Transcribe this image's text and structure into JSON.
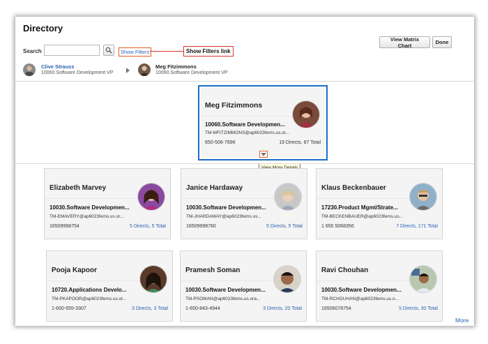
{
  "page": {
    "title": "Directory",
    "search_label": "Search",
    "search_value": "",
    "show_filters": "Show Filters",
    "callout": "Show Filters link",
    "btn_matrix": "View Matrix Chart",
    "btn_done": "Done",
    "more": "More",
    "tooltip": "View More Details"
  },
  "breadcrumb": [
    {
      "name": "Clive Strauss",
      "org": "10060.Software Development VP"
    },
    {
      "name": "Meg Fitzimmons",
      "org": "10060.Software Development VP"
    }
  ],
  "featured": {
    "name": "Meg Fitzimmons",
    "dept": "10060.Software Developmen...",
    "email": "TM-MFITZIMMONS@ap6023fems.us.or...",
    "phone": "650-506-7896",
    "directs": "19 Directs, 87 Total"
  },
  "reports": [
    {
      "name": "Elizabeth Marvey",
      "dept": "10030.Software Developmen...",
      "email": "TM-EMAVERY@ap6023fems.us.or...",
      "phone": "16509998754",
      "directs": "5 Directs, 5 Total"
    },
    {
      "name": "Janice Hardaway",
      "dept": "10030.Software Developmen...",
      "email": "TM-JHARDAWAY@ap6023fems.us...",
      "phone": "16509998760",
      "directs": "5 Directs, 5 Total"
    },
    {
      "name": "Klaus Beckenbauer",
      "dept": "17230.Product Mgmt/Strate...",
      "email": "TM-BECKENBAUER@ap6023fems.us...",
      "phone": "1 650 5068356",
      "directs": "7 Directs, 171 Total"
    },
    {
      "name": "Pooja Kapoor",
      "dept": "10720.Applications Develo...",
      "email": "TM-PKAPOOR@ap6023fems.us.or...",
      "phone": "1-650-555-3307",
      "directs": "3 Directs, 3 Total"
    },
    {
      "name": "Pramesh Soman",
      "dept": "10030.Software Developmen...",
      "email": "TM-PSOMAN@ap6023fems.us.ora...",
      "phone": "1-650-843-4944",
      "directs": "3 Directs, 20 Total"
    },
    {
      "name": "Ravi Chouhan",
      "dept": "10030.Software Developmen...",
      "email": "TM-RCHOUHAN@ap6023fems.us.o...",
      "phone": "16506078754",
      "directs": "5 Directs, 30 Total"
    }
  ],
  "icons": {
    "search": "search-icon",
    "view_more": "chevron-down-icon",
    "breadcrumb_arrow": "chevron-right-icon"
  },
  "colors": {
    "link": "#2a62b3",
    "highlight_border": "#1b6cc8",
    "callout_border": "#d9332e",
    "card_background": "#f4f4f4"
  }
}
